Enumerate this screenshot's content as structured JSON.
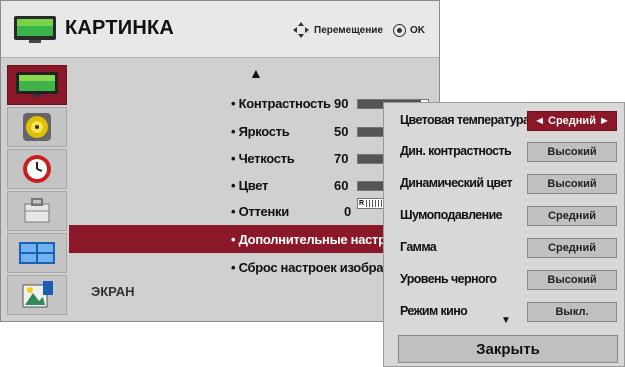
{
  "header": {
    "title": "КАРТИНКА",
    "nav_move_label": "Перемещение",
    "nav_ok_label": "OK"
  },
  "sidebar": {
    "items": [
      {
        "icon": "tv-picture-icon",
        "active": true
      },
      {
        "icon": "speaker-audio-icon",
        "active": false
      },
      {
        "icon": "clock-time-icon",
        "active": false
      },
      {
        "icon": "toolbox-options-icon",
        "active": false
      },
      {
        "icon": "screen-input-icon",
        "active": false
      },
      {
        "icon": "photo-usb-icon",
        "active": false
      }
    ]
  },
  "menu": {
    "items": [
      {
        "label": "• Контрастность",
        "value": "90",
        "level": 0.9
      },
      {
        "label": "• Яркость",
        "value": "50",
        "level": 0.5
      },
      {
        "label": "• Четкость",
        "value": "70",
        "level": 0.7
      },
      {
        "label": "• Цвет",
        "value": "60",
        "level": 0.6
      },
      {
        "label": "• Оттенки",
        "value": "0",
        "tint_marker": "R"
      },
      {
        "label": "• Дополнительные настройки"
      },
      {
        "label": "• Сброс настроек изображения"
      }
    ],
    "screen_label": "ЭКРАН"
  },
  "submenu": {
    "rows": [
      {
        "label": "Цветовая температура",
        "value": "Средний",
        "selected": true
      },
      {
        "label": "Дин. контрастность",
        "value": "Высокий"
      },
      {
        "label": "Динамический цвет",
        "value": "Высокий"
      },
      {
        "label": "Шумоподавление",
        "value": "Средний"
      },
      {
        "label": "Гамма",
        "value": "Средний"
      },
      {
        "label": "Уровень черного",
        "value": "Высокий"
      },
      {
        "label": "Режим кино",
        "value": "Выкл."
      }
    ],
    "close_label": "Закрыть",
    "selected_display": "◄ Средний ►"
  },
  "colors": {
    "accent": "#8b1828",
    "panel": "#d0d0d0",
    "header": "#e8e8e8"
  }
}
